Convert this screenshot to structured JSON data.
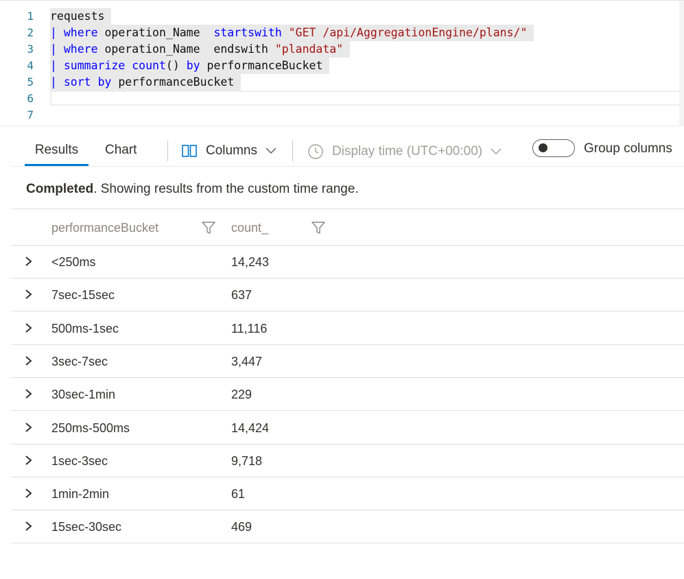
{
  "editor": {
    "lines": [
      {
        "num": "1",
        "tokens": [
          {
            "t": "requests",
            "c": "plain"
          }
        ]
      },
      {
        "num": "2",
        "tokens": [
          {
            "t": "| ",
            "c": "pipe"
          },
          {
            "t": "where",
            "c": "kw"
          },
          {
            "t": " operation_Name  ",
            "c": "plain"
          },
          {
            "t": "startswith",
            "c": "kw"
          },
          {
            "t": " ",
            "c": "plain"
          },
          {
            "t": "\"GET /api/AggregationEngine/plans/\"",
            "c": "str"
          }
        ]
      },
      {
        "num": "3",
        "tokens": [
          {
            "t": "| ",
            "c": "pipe"
          },
          {
            "t": "where",
            "c": "kw"
          },
          {
            "t": " operation_Name  endswith ",
            "c": "plain"
          },
          {
            "t": "\"plandata\"",
            "c": "str"
          }
        ]
      },
      {
        "num": "4",
        "tokens": [
          {
            "t": "| ",
            "c": "pipe"
          },
          {
            "t": "summarize",
            "c": "kw"
          },
          {
            "t": " ",
            "c": "plain"
          },
          {
            "t": "count",
            "c": "kw"
          },
          {
            "t": "() ",
            "c": "plain"
          },
          {
            "t": "by",
            "c": "kw"
          },
          {
            "t": " performanceBucket",
            "c": "plain"
          }
        ]
      },
      {
        "num": "5",
        "tokens": [
          {
            "t": "| ",
            "c": "pipe"
          },
          {
            "t": "sort",
            "c": "kw"
          },
          {
            "t": " ",
            "c": "plain"
          },
          {
            "t": "by",
            "c": "kw"
          },
          {
            "t": " performanceBucket",
            "c": "plain"
          }
        ]
      },
      {
        "num": "6",
        "tokens": []
      },
      {
        "num": "7",
        "tokens": []
      }
    ]
  },
  "tabs": {
    "results": "Results",
    "chart": "Chart"
  },
  "toolbar": {
    "columns_label": "Columns",
    "display_time_label": "Display time (UTC+00:00)",
    "group_columns_label": "Group columns",
    "group_columns_on": false
  },
  "status": {
    "bold": "Completed",
    "rest": ". Showing results from the custom time range."
  },
  "grid": {
    "headers": [
      "performanceBucket",
      "count_"
    ],
    "rows": [
      {
        "bucket": "<250ms",
        "count": "14,243"
      },
      {
        "bucket": "7sec-15sec",
        "count": "637"
      },
      {
        "bucket": "500ms-1sec",
        "count": "11,116"
      },
      {
        "bucket": "3sec-7sec",
        "count": "3,447"
      },
      {
        "bucket": "30sec-1min",
        "count": "229"
      },
      {
        "bucket": "250ms-500ms",
        "count": "14,424"
      },
      {
        "bucket": "1sec-3sec",
        "count": "9,718"
      },
      {
        "bucket": "1min-2min",
        "count": "61"
      },
      {
        "bucket": "15sec-30sec",
        "count": "469"
      }
    ]
  },
  "colors": {
    "accent": "#0078d4",
    "keyword": "#0000ff",
    "string": "#a31515",
    "line_number": "#237893"
  },
  "icons": {
    "columns": "columns-icon",
    "clock": "clock-icon",
    "filter": "filter-icon",
    "expand": "chevron-right-icon",
    "dropdown": "chevron-down-icon"
  }
}
